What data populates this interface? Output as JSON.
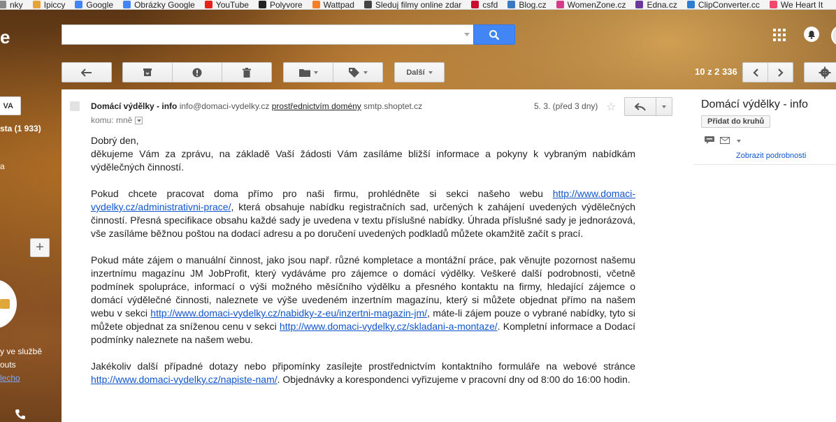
{
  "bookmarks": [
    {
      "label": "nky",
      "icon": "bookmark-fragment-icon",
      "color": "#888888"
    },
    {
      "label": "Ipiccy",
      "icon": "ipiccy-icon",
      "color": "#e8a23a"
    },
    {
      "label": "Google",
      "icon": "google-icon",
      "color": "#4285f4"
    },
    {
      "label": "Obrázky Google",
      "icon": "google-icon",
      "color": "#4285f4"
    },
    {
      "label": "YouTube",
      "icon": "youtube-icon",
      "color": "#e62117"
    },
    {
      "label": "Polyvore",
      "icon": "polyvore-icon",
      "color": "#222222"
    },
    {
      "label": "Wattpad",
      "icon": "wattpad-icon",
      "color": "#f57f28"
    },
    {
      "label": "Sleduj filmy online zdar",
      "icon": "film-icon",
      "color": "#444444"
    },
    {
      "label": "csfd",
      "icon": "csfd-icon",
      "color": "#c8102e"
    },
    {
      "label": "Blog.cz",
      "icon": "blog-icon",
      "color": "#3a78c2"
    },
    {
      "label": "WomenZone.cz",
      "icon": "womenzone-icon",
      "color": "#d63a8a"
    },
    {
      "label": "Edna.cz",
      "icon": "edna-icon",
      "color": "#6a3a9a"
    },
    {
      "label": "ClipConverter.cc",
      "icon": "clipconverter-icon",
      "color": "#2d7dd2"
    },
    {
      "label": "We Heart It",
      "icon": "weheartit-icon",
      "color": "#f0476b"
    }
  ],
  "header": {
    "logo_fragment": "e",
    "search_placeholder": ""
  },
  "toolbar": {
    "more_label": "Další",
    "pager": "10 z 2 336"
  },
  "sidebar": {
    "compose_label": "VA",
    "inbox_label": "sta (1 933)",
    "item_fragment": "a",
    "hangouts_line1": "y ve službě",
    "hangouts_line2": "outs",
    "hangouts_link": "lecho"
  },
  "email": {
    "sender_name": "Domácí výdělky - info",
    "sender_email": "info@domaci-vydelky.cz",
    "via_label": "prostřednictvím domény",
    "via_domain": "smtp.shoptet.cz",
    "to_label": "komu: mně",
    "date": "5. 3. (před 3 dny)",
    "greeting": "Dobrý den,",
    "p1": "děkujeme Vám za zprávu, na základě Vaší žádosti Vám zasíláme bližší informace a pokyny k vybraným nabídkám výdělečných činností.",
    "p2_a": "Pokud chcete pracovat doma přímo pro naši firmu, prohlédněte si sekci našeho webu ",
    "p2_link": "http://www.domaci-vydelky.cz/administrativni-prace/",
    "p2_b": ", která obsahuje nabídku registračních sad, určených k zahájení uvedených výdělečných činností. Přesná specifikace obsahu každé sady je uvedena v  textu příslušné nabídky. Úhrada příslušné sady je jednorázová, vše zasíláme běžnou poštou na dodací adresu a po doručení uvedených podkladů můžete okamžitě začít s prací.",
    "p3_a": "Pokud máte zájem o manuální činnost, jako jsou např. různé kompletace a montážní práce, pak věnujte pozornost našemu inzertnímu magazínu JM JobProfit, který vydáváme pro zájemce o domácí výdělky. Veškeré další podrobnosti, včetně podmínek spolupráce, informací o výši možného měsíčního výdělku a přesného kontaktu na firmy, hledající zájemce o domácí výdělečné činnosti, naleznete ve výše uvedeném inzertním magazínu, který si můžete objednat přímo na našem webu v sekci ",
    "p3_link1": "http://www.domaci-vydelky.cz/nabidky-z-eu/inzertni-magazin-jm/",
    "p3_b": ", máte-li zájem pouze o vybrané nabídky, tyto si můžete objednat za sníženou cenu v sekci ",
    "p3_link2": "http://www.domaci-vydelky.cz/skladani-a-montaze/",
    "p3_c": ". Kompletní informace a Dodací podmínky naleznete na našem webu.",
    "p4_a": "Jakékoliv další případné dotazy nebo připomínky zasílejte prostřednictvím kontaktního formuláře na webové stránce ",
    "p4_link": "http://www.domaci-vydelky.cz/napiste-nam/",
    "p4_b": ". Objednávky a korespondenci vyřizujeme v pracovní dny od 8:00 do 16:00 hodin."
  },
  "contact_panel": {
    "name": "Domácí výdělky - info",
    "add_to_circles": "Přidat do kruhů",
    "details_link": "Zobrazit podrobnosti"
  },
  "colors": {
    "search_blue": "#4285f4",
    "link_blue": "#1155cc"
  }
}
